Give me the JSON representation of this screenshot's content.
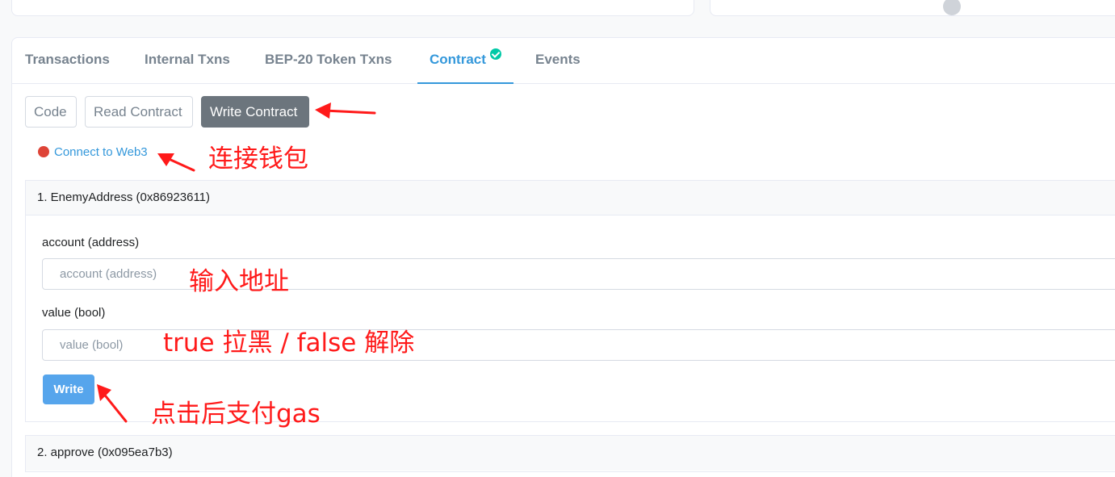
{
  "tabs": [
    {
      "label": "Transactions"
    },
    {
      "label": "Internal Txns"
    },
    {
      "label": "BEP-20 Token Txns"
    },
    {
      "label": "Contract"
    },
    {
      "label": "Events"
    }
  ],
  "subtabs": {
    "code": "Code",
    "read": "Read Contract",
    "write": "Write Contract"
  },
  "web3": {
    "link": "Connect to Web3"
  },
  "functions": [
    {
      "title": "1. EnemyAddress (0x86923611)",
      "inputs": [
        {
          "label": "account (address)",
          "placeholder": "account (address)"
        },
        {
          "label": "value (bool)",
          "placeholder": "value (bool)"
        }
      ],
      "button": "Write"
    },
    {
      "title": "2. approve (0x095ea7b3)"
    }
  ],
  "annotations": {
    "connect": "连接钱包",
    "address": "输入地址",
    "value": "true 拉黑 / false 解除",
    "write": "点击后支付gas"
  },
  "colors": {
    "accent": "#3498db",
    "verified": "#00c9a7",
    "status_dot": "#de4437",
    "annotation": "#ff1a1a",
    "write_button": "#56a5ec"
  }
}
